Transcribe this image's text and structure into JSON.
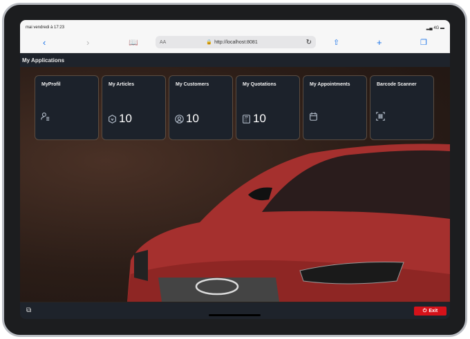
{
  "status": {
    "time": "mai vendredi à 17:23",
    "network": "4G"
  },
  "browser": {
    "text_size": "AA",
    "url": "http://localhost:8081"
  },
  "header": {
    "title": "My Applications"
  },
  "tiles": [
    {
      "label": "MyProfil",
      "icon": "user-list-icon",
      "count": null
    },
    {
      "label": "My Articles",
      "icon": "box-icon",
      "count": "10"
    },
    {
      "label": "My Customers",
      "icon": "user-circle-icon",
      "count": "10"
    },
    {
      "label": "My Quotations",
      "icon": "calculator-icon",
      "count": "10"
    },
    {
      "label": "My Appointments",
      "icon": "calendar-icon",
      "count": null
    },
    {
      "label": "Barcode Scanner",
      "icon": "barcode-scan-icon",
      "count": null
    }
  ],
  "footer": {
    "exit_label": "Exit"
  },
  "colors": {
    "exit": "#d5121a",
    "bar": "#1e232b",
    "tile": "#1c222b"
  }
}
